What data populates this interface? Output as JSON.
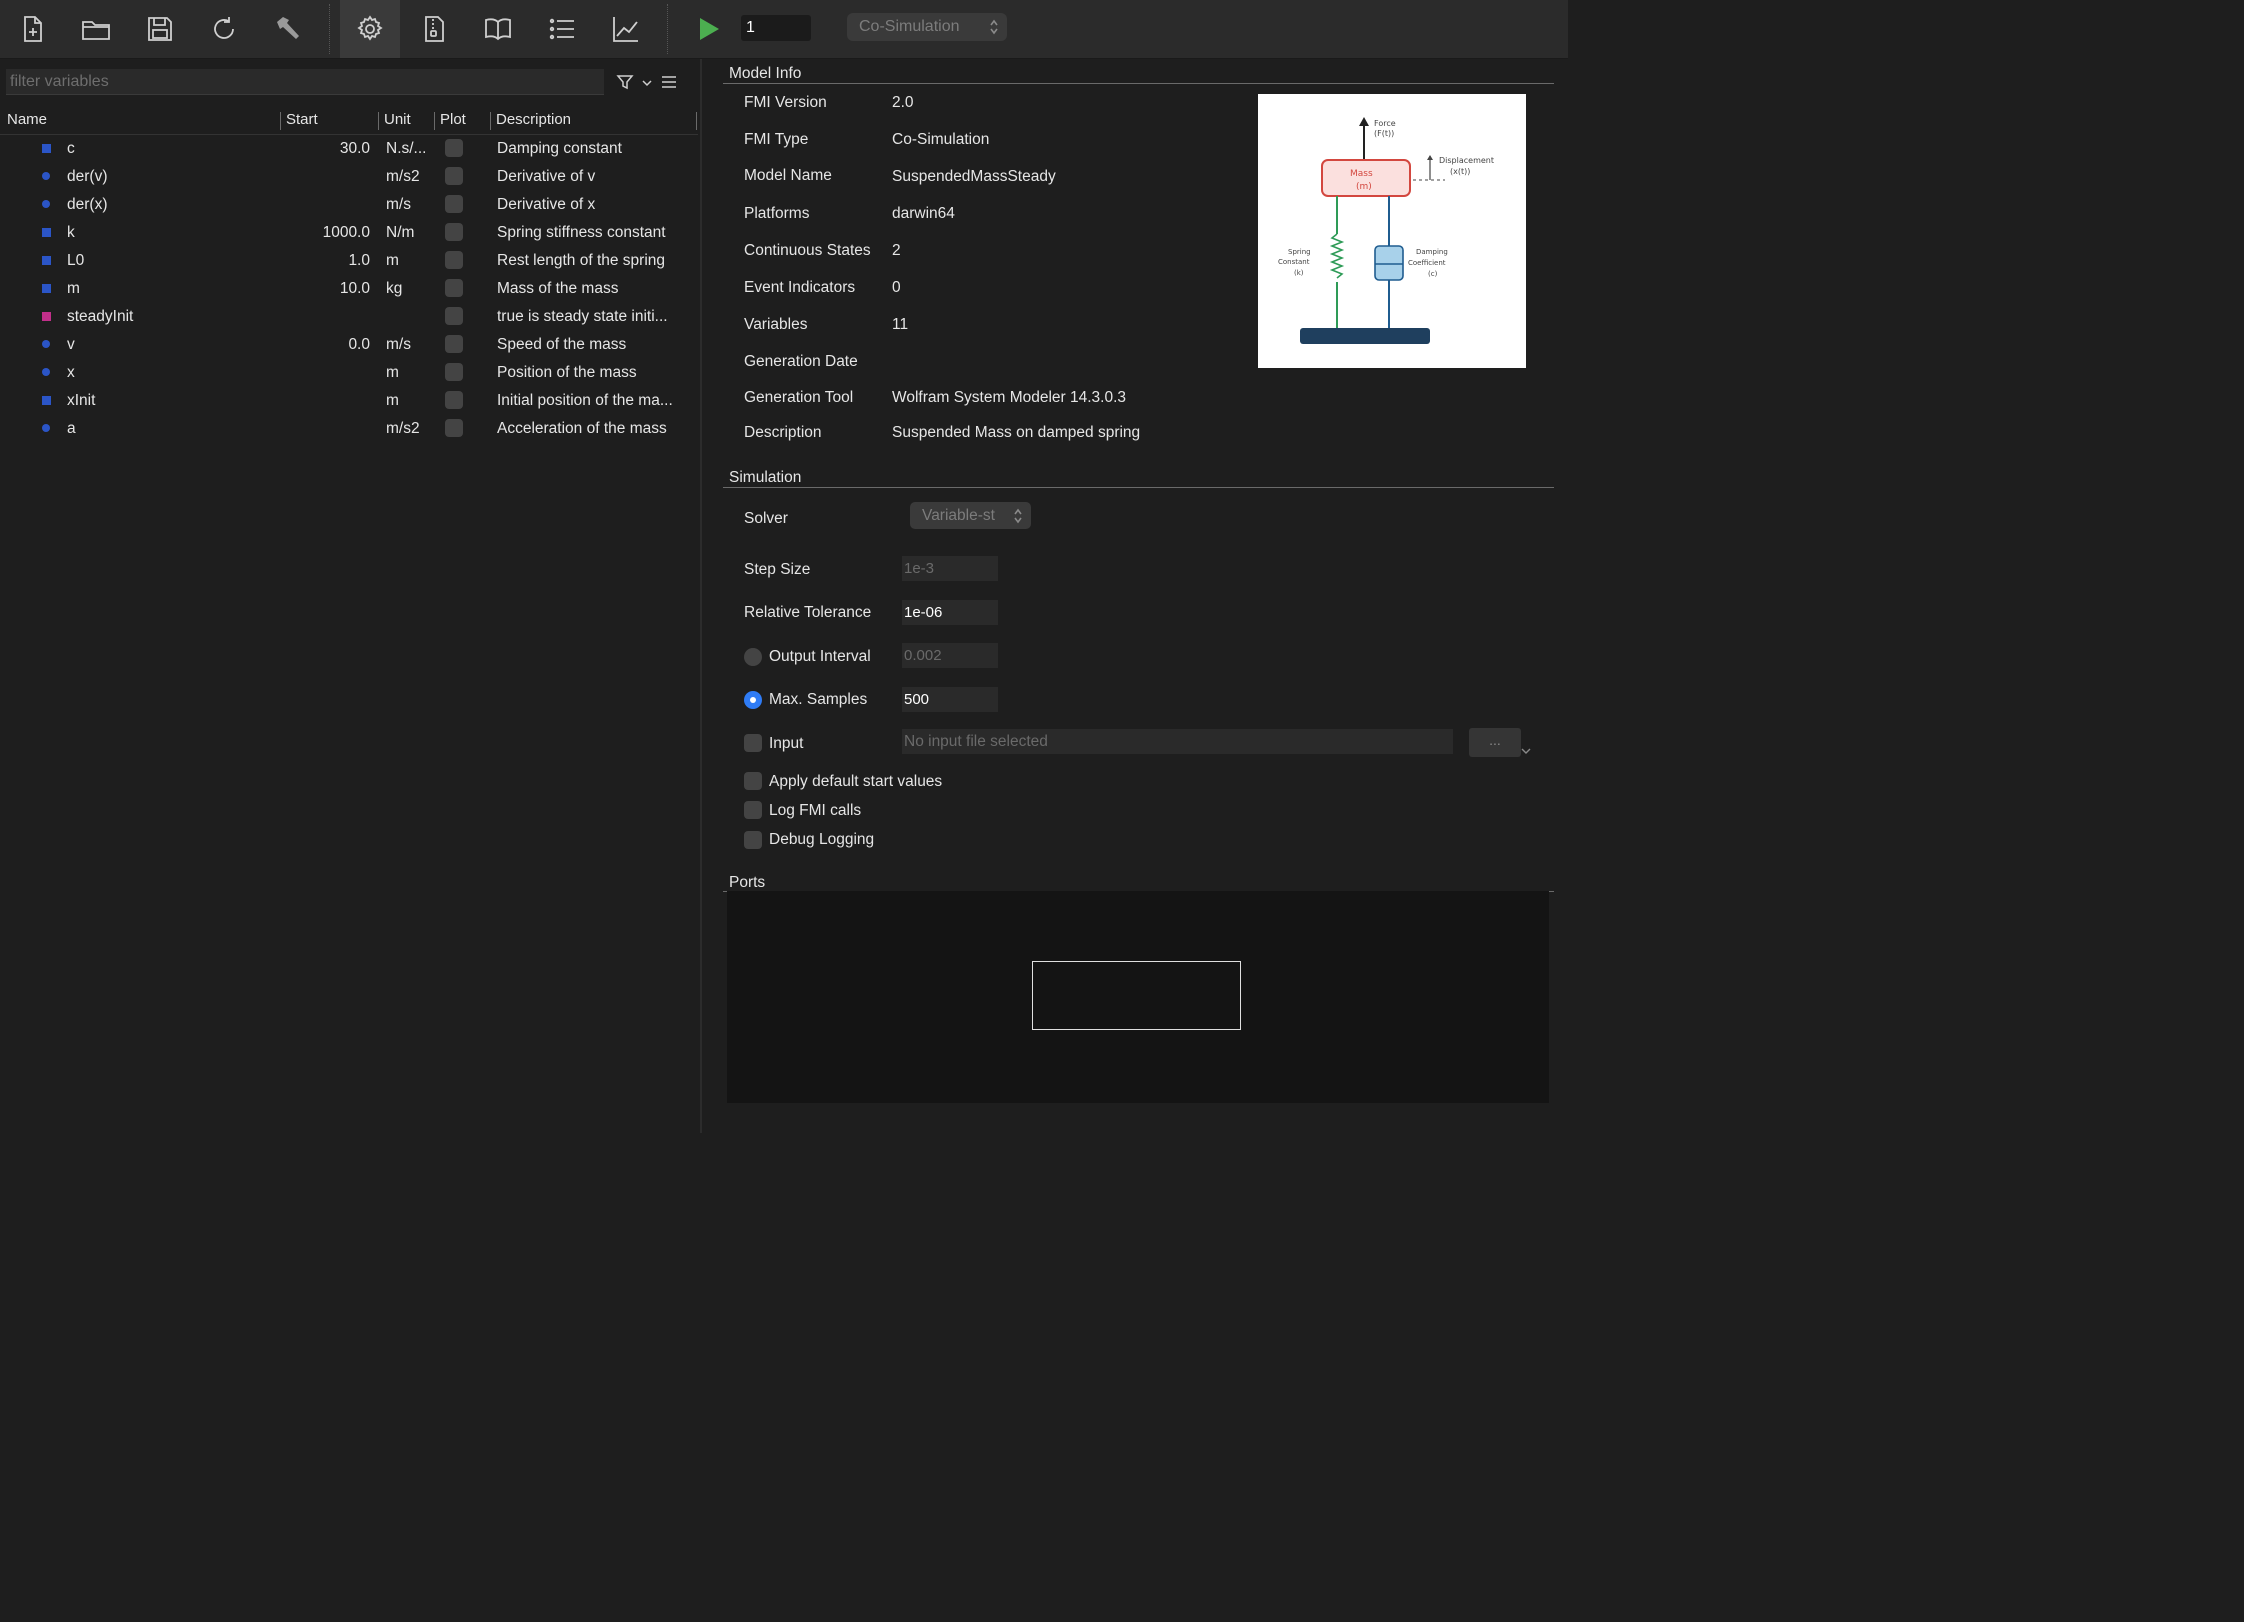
{
  "toolbar": {
    "buttons": [
      "new-file",
      "open-folder",
      "save",
      "reload",
      "build",
      "settings",
      "archive-file",
      "documentation",
      "list-view",
      "plot-chart"
    ],
    "active": "settings",
    "run_count": "1",
    "mode": "Co-Simulation"
  },
  "variables_panel": {
    "filter_placeholder": "filter variables",
    "columns": {
      "name": "Name",
      "start": "Start",
      "unit": "Unit",
      "plot": "Plot",
      "description": "Description"
    },
    "rows": [
      {
        "name": "c",
        "start": "30.0",
        "unit": "N.s/...",
        "description": "Damping constant",
        "kind": "parameter"
      },
      {
        "name": "der(v)",
        "start": "",
        "unit": "m/s2",
        "description": "Derivative of v",
        "kind": "state"
      },
      {
        "name": "der(x)",
        "start": "",
        "unit": "m/s",
        "description": "Derivative of x",
        "kind": "state"
      },
      {
        "name": "k",
        "start": "1000.0",
        "unit": "N/m",
        "description": "Spring stiffness constant",
        "kind": "parameter"
      },
      {
        "name": "L0",
        "start": "1.0",
        "unit": "m",
        "description": "Rest length of the spring",
        "kind": "parameter"
      },
      {
        "name": "m",
        "start": "10.0",
        "unit": "kg",
        "description": "Mass of the mass",
        "kind": "parameter"
      },
      {
        "name": "steadyInit",
        "start": "",
        "unit": "",
        "description": "true is steady state initi...",
        "kind": "boolean"
      },
      {
        "name": "v",
        "start": "0.0",
        "unit": "m/s",
        "description": "Speed of the mass",
        "kind": "state"
      },
      {
        "name": "x",
        "start": "",
        "unit": "m",
        "description": "Position of the mass",
        "kind": "state"
      },
      {
        "name": "xInit",
        "start": "",
        "unit": "m",
        "description": "Initial position of the ma...",
        "kind": "parameter"
      },
      {
        "name": "a",
        "start": "",
        "unit": "m/s2",
        "description": "Acceleration of the mass",
        "kind": "state"
      }
    ]
  },
  "model_info": {
    "title": "Model Info",
    "fields": [
      {
        "label": "FMI Version",
        "value": "2.0"
      },
      {
        "label": "FMI Type",
        "value": "Co-Simulation"
      },
      {
        "label": "Model Name",
        "value": "SuspendedMassSteady"
      },
      {
        "label": "Platforms",
        "value": "darwin64"
      },
      {
        "label": "Continuous States",
        "value": "2"
      },
      {
        "label": "Event Indicators",
        "value": "0"
      },
      {
        "label": "Variables",
        "value": "11"
      },
      {
        "label": "Generation Date",
        "value": ""
      },
      {
        "label": "Generation Tool",
        "value": "Wolfram System Modeler 14.3.0.3"
      },
      {
        "label": "Description",
        "value": "Suspended Mass on damped spring"
      }
    ],
    "diagram": {
      "force": "Force",
      "force_sym": "(F(t))",
      "mass": "Mass",
      "mass_sym": "(m)",
      "displacement": "Displacement",
      "displacement_sym": "(x(t))",
      "spring": "Spring",
      "spring2": "Constant",
      "spring_sym": "(k)",
      "damping": "Damping",
      "damping2": "Coefficient",
      "damping_sym": "(c)"
    }
  },
  "simulation": {
    "title": "Simulation",
    "solver_label": "Solver",
    "solver_value": "Variable-st",
    "step_size_label": "Step Size",
    "step_size_value": "1e-3",
    "rel_tol_label": "Relative Tolerance",
    "rel_tol_value": "1e-06",
    "output_interval_label": "Output Interval",
    "output_interval_value": "0.002",
    "max_samples_label": "Max. Samples",
    "max_samples_value": "500",
    "input_label": "Input",
    "input_placeholder": "No input file selected",
    "browse_label": "...",
    "apply_defaults_label": "Apply default start values",
    "log_fmi_label": "Log FMI calls",
    "debug_logging_label": "Debug Logging"
  },
  "ports": {
    "title": "Ports"
  },
  "colors": {
    "accent": "#2f7cf6",
    "run_green": "#4caf50",
    "parameter_marker": "#2b55c7",
    "boolean_marker": "#c22f8a"
  }
}
